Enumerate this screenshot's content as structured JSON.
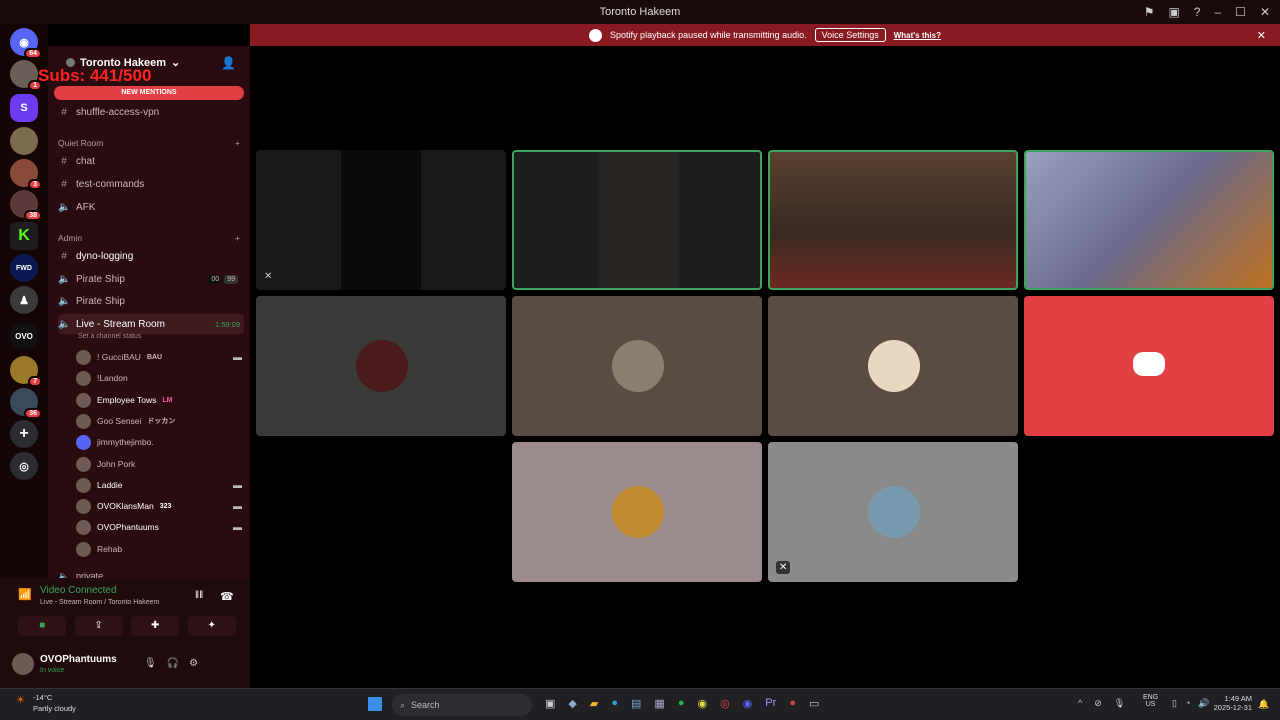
{
  "window": {
    "title": "Toronto Hakeem"
  },
  "banner": {
    "text": "Spotify playback paused while transmitting audio.",
    "button": "Voice Settings",
    "link": "What's this?"
  },
  "servers": {
    "badge_top": "64",
    "badges": [
      "1",
      "3",
      "38",
      "7",
      "36"
    ]
  },
  "sidebar": {
    "server_name": "Toronto Hakeem",
    "overlay_subs": "Subs: 441/500",
    "new_mentions": "NEW MENTIONS",
    "channels_top": [
      "shuffle-access-vpn"
    ],
    "category_quiet": "Quiet Room",
    "quiet_channels": [
      "chat",
      "test-commands",
      "AFK"
    ],
    "category_admin": "Admin",
    "admin_channels": [
      "dyno-logging",
      "Pirate Ship",
      "Pirate Ship"
    ],
    "pirate_badges": [
      "00",
      "99"
    ],
    "live_room": {
      "name": "Live - Stream Room",
      "time": "1:59:09",
      "status": "Set a channel status"
    },
    "members": [
      {
        "name": "! GucciBAU",
        "tag": "BAU"
      },
      {
        "name": "!Landon",
        "tag": ""
      },
      {
        "name": "Employee Tows",
        "tag": "LM"
      },
      {
        "name": "Goo Sensei",
        "tag": "ドッカン"
      },
      {
        "name": "jimmythejimbo.",
        "tag": ""
      },
      {
        "name": "John Pork",
        "tag": ""
      },
      {
        "name": "Laddie",
        "tag": ""
      },
      {
        "name": "OVOKlansMan",
        "tag": "323"
      },
      {
        "name": "OVOPhantuums",
        "tag": ""
      },
      {
        "name": "Rehab",
        "tag": ""
      }
    ],
    "next_category": "private"
  },
  "voice_panel": {
    "status": "Video Connected",
    "location": "Live - Stream Room / Toronto Hakeem"
  },
  "user": {
    "name": "OVOPhantuums",
    "status": "In voice"
  },
  "taskbar": {
    "temp": "-14°C",
    "weather": "Partly cloudy",
    "search": "Search",
    "lang": "ENG",
    "region": "US",
    "time": "1:49 AM",
    "date": "2025-12-31"
  },
  "colors": {
    "accent": "#e23f44",
    "banner": "#8a1a22",
    "speaking": "#3ba55c"
  }
}
